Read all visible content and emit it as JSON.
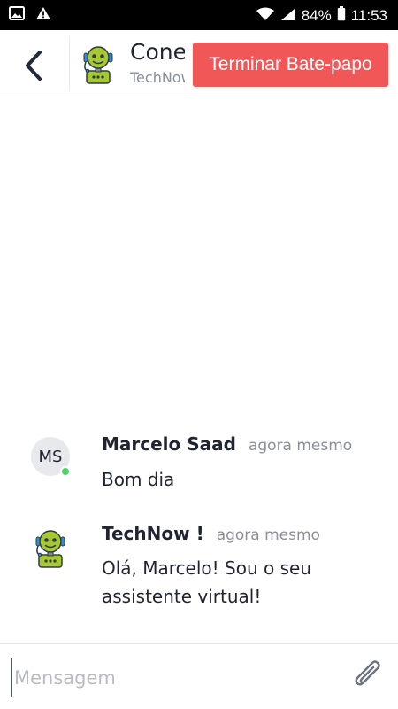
{
  "status_bar": {
    "battery": "84%",
    "time": "11:53",
    "icons": [
      "image-icon",
      "warning-icon",
      "wifi-icon",
      "signal-icon",
      "battery-icon"
    ]
  },
  "header": {
    "title": "Conexão",
    "subtitle": "TechNow",
    "end_chat_label": "Terminar Bate-papo",
    "end_chat_color": "#f25757"
  },
  "messages": [
    {
      "author": "Marcelo Saad",
      "avatar_initials": "MS",
      "online": true,
      "time": "agora mesmo",
      "text": "Bom dia"
    },
    {
      "author": "TechNow !",
      "avatar": "robot-icon",
      "time": "agora mesmo",
      "text": "Olá, Marcelo! Sou o seu assistente virtual!"
    }
  ],
  "composer": {
    "placeholder": "Mensagem",
    "value": ""
  },
  "colors": {
    "online": "#52d36b",
    "robot_green": "#a6c931"
  }
}
